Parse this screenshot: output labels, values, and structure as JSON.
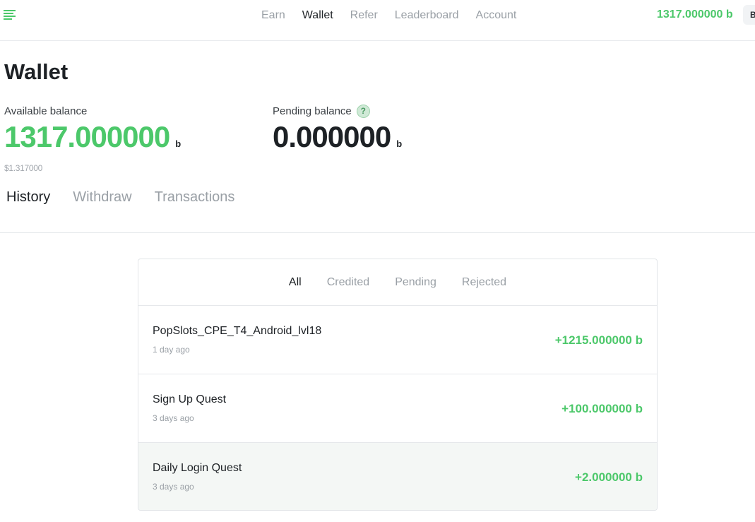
{
  "nav": {
    "items": [
      {
        "label": "Earn",
        "active": false
      },
      {
        "label": "Wallet",
        "active": true
      },
      {
        "label": "Refer",
        "active": false
      },
      {
        "label": "Leaderboard",
        "active": false
      },
      {
        "label": "Account",
        "active": false
      }
    ],
    "balance": "1317.000000 b",
    "badge": "B"
  },
  "page": {
    "title": "Wallet"
  },
  "balances": {
    "available": {
      "label": "Available balance",
      "amount": "1317.000000",
      "unit": "b",
      "usd": "$1.317000"
    },
    "pending": {
      "label": "Pending balance",
      "amount": "0.000000",
      "unit": "b",
      "help_icon": "?"
    }
  },
  "tabs": [
    {
      "label": "History",
      "active": true
    },
    {
      "label": "Withdraw",
      "active": false
    },
    {
      "label": "Transactions",
      "active": false
    }
  ],
  "filters": [
    {
      "label": "All",
      "active": true
    },
    {
      "label": "Credited",
      "active": false
    },
    {
      "label": "Pending",
      "active": false
    },
    {
      "label": "Rejected",
      "active": false
    }
  ],
  "transactions": [
    {
      "name": "PopSlots_CPE_T4_Android_lvl18",
      "time": "1 day ago",
      "amount": "+1215.000000 b"
    },
    {
      "name": "Sign Up Quest",
      "time": "3 days ago",
      "amount": "+100.000000 b"
    },
    {
      "name": "Daily Login Quest",
      "time": "3 days ago",
      "amount": "+2.000000 b"
    }
  ],
  "colors": {
    "accent": "#4cc86a",
    "text": "#1d2125",
    "muted": "#9aa0a6"
  },
  "icons": {
    "logo": "menu-lines-icon",
    "pending_help": "question-icon"
  }
}
